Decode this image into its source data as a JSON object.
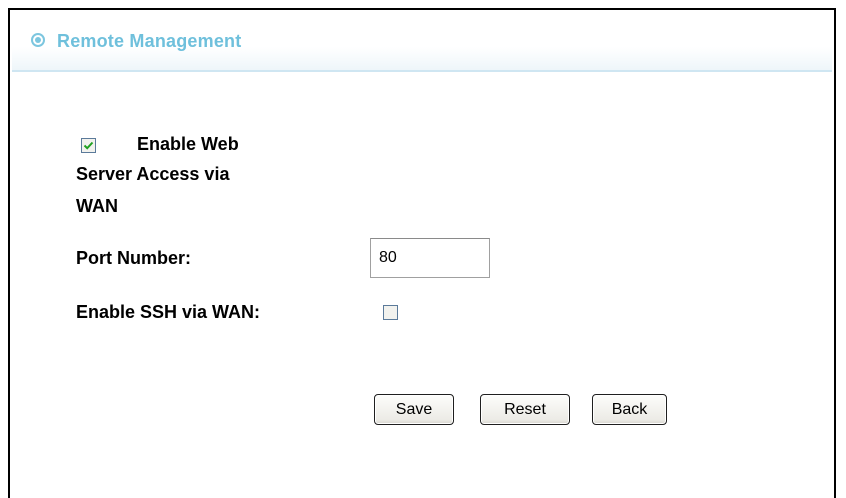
{
  "section": {
    "title": "Remote Management"
  },
  "form": {
    "web_access": {
      "line1": "Enable Web",
      "line2": "Server Access via",
      "line3": "WAN",
      "checked": true
    },
    "port": {
      "label": "Port Number:",
      "value": "80"
    },
    "ssh": {
      "label": "Enable SSH via WAN:",
      "checked": false
    }
  },
  "buttons": {
    "save": "Save",
    "reset": "Reset",
    "back": "Back"
  },
  "colors": {
    "title": "#6fc0dc",
    "checkmark": "#21a121"
  }
}
